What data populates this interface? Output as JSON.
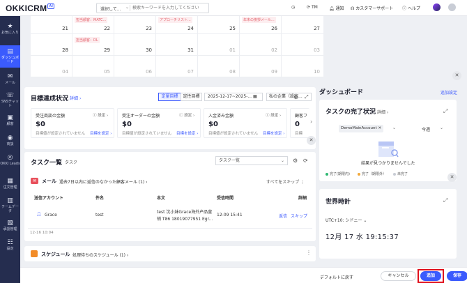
{
  "header": {
    "logo": "OKKICRM",
    "logo_badge": "AI",
    "search_select": "選択して...",
    "search_placeholder": "検索キーワードを入力してください",
    "tm": "TM",
    "notify": "通知",
    "support": "カスタマーサポート",
    "help": "ヘルプ"
  },
  "sidebar": {
    "items": [
      {
        "label": "お気に入り",
        "icon": "star-icon"
      },
      {
        "label": "ダッシュボード",
        "icon": "dashboard-icon"
      },
      {
        "label": "メール",
        "icon": "mail-icon"
      },
      {
        "label": "SNSチャット",
        "icon": "chat-icon"
      },
      {
        "label": "顧客",
        "icon": "customer-icon"
      },
      {
        "label": "商談",
        "icon": "deal-icon"
      },
      {
        "label": "OKKI Leads",
        "icon": "leads-icon"
      },
      {
        "label": "注文管理",
        "icon": "order-icon"
      },
      {
        "label": "チームデータ",
        "icon": "team-data-icon"
      },
      {
        "label": "承認管理",
        "icon": "approval-icon"
      },
      {
        "label": "設定",
        "icon": "settings-icon"
      }
    ]
  },
  "calendar": {
    "rows": [
      [
        {
          "day": "21",
          "tag": ""
        },
        {
          "day": "22",
          "tag": "担当顧客：MATC..."
        },
        {
          "day": "23",
          "tag": ""
        },
        {
          "day": "24",
          "tag": "アプローチリスト..."
        },
        {
          "day": "25",
          "tag": ""
        },
        {
          "day": "26",
          "tag": "年末の挨拶メール..."
        },
        {
          "day": "27",
          "tag": ""
        }
      ],
      [
        {
          "day": "28",
          "tag": ""
        },
        {
          "day": "29",
          "tag": "担当顧客：DL"
        },
        {
          "day": "30",
          "tag": ""
        },
        {
          "day": "31",
          "tag": ""
        },
        {
          "day": "01",
          "tag": ""
        },
        {
          "day": "02",
          "tag": ""
        },
        {
          "day": "03",
          "tag": ""
        }
      ],
      [
        {
          "day": "04",
          "tag": ""
        },
        {
          "day": "05",
          "tag": ""
        },
        {
          "day": "06",
          "tag": ""
        },
        {
          "day": "07",
          "tag": ""
        },
        {
          "day": "08",
          "tag": ""
        },
        {
          "day": "09",
          "tag": ""
        },
        {
          "day": "10",
          "tag": ""
        }
      ]
    ]
  },
  "goals": {
    "title": "目標達成状況",
    "detail": "詳細",
    "tab_quant": "定量目標",
    "tab_qual": "定性目標",
    "date_range": "2025-12-17~2025-...",
    "company": "私の企業（設定...",
    "cards": [
      {
        "label": "受注商談の金額",
        "settings": "設定",
        "value": "$0",
        "note": "目標値が設定されていません",
        "link": "目標を設定"
      },
      {
        "label": "受注オーダーの金額",
        "settings": "設定",
        "value": "$0",
        "note": "目標値が設定されていません",
        "link": "目標を設定"
      },
      {
        "label": "入金済み金額",
        "settings": "設定",
        "value": "$0",
        "note": "目標値が設定されていません",
        "link": "目標を設定"
      },
      {
        "label": "顧客フ",
        "settings": "",
        "value": "0",
        "note": "目標",
        "link": ""
      }
    ]
  },
  "tasks": {
    "title": "タスク一覧",
    "subtitle": "タスク",
    "select": "タスク一覧",
    "mail_title": "メール",
    "mail_subtitle": "過去7日以内に返信のなかった顧客メール (1)",
    "skip_all": "すべてをスキップ",
    "headers": [
      "送信アカウント",
      "件名",
      "本文",
      "受信時間",
      "詳細"
    ],
    "row": {
      "account": "Grace",
      "subject": "test",
      "body_line1": "test 沈小妹Grace海外产品营",
      "body_line2": "销 T86 18019077951 Egr...",
      "time": "12-09 15:41",
      "reply": "返信",
      "skip": "スキップ"
    },
    "date": "12-16 10:04"
  },
  "schedule": {
    "title": "スケジュール",
    "subtitle": "処理待ちのスケジュール (1)"
  },
  "dashboard": {
    "title": "ダッシュボード",
    "add_settings": "追加設定"
  },
  "task_completion": {
    "title": "タスクの完了状況",
    "detail": "詳細",
    "account": "DemoMainAccount",
    "period": "今週",
    "empty": "結果が見つかりませんでした",
    "legend": [
      {
        "label": "完了(期限内)",
        "color": "#2eb872"
      },
      {
        "label": "完了（期限外）",
        "color": "#f2a93b"
      },
      {
        "label": "未完了",
        "color": "#c8ccd4"
      }
    ]
  },
  "world_clock": {
    "title": "世界時計",
    "timezone": "UTC+10: シドニー",
    "datetime": "12月 17  水  19:15:37"
  },
  "footer": {
    "reset": "デフォルトに戻す",
    "cancel": "キャンセル",
    "add": "追加",
    "save": "保存"
  },
  "colors": {
    "accent": "#3b5bfd",
    "sidebar": "#252d4f",
    "highlight": "#e0101c"
  }
}
